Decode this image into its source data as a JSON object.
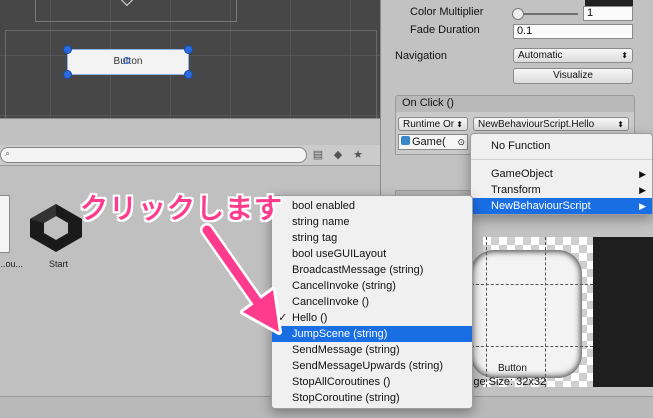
{
  "scene": {
    "button_text": "Button"
  },
  "project": {
    "assets": [
      {
        "label": "...ou..."
      },
      {
        "label": "Start"
      }
    ]
  },
  "inspector": {
    "color_multiplier_label": "Color Multiplier",
    "color_multiplier_value": "1",
    "fade_duration_label": "Fade Duration",
    "fade_duration_value": "0.1",
    "navigation_label": "Navigation",
    "navigation_value": "Automatic",
    "visualize_label": "Visualize",
    "onclick_header": "On Click ()",
    "runtime_value": "Runtime Or",
    "function_value": "NewBehaviourScript.Hello",
    "object_value": "Game("
  },
  "preview": {
    "title": "Button",
    "size_text": "Image Size: 32x32"
  },
  "function_menu": {
    "items": [
      {
        "label": "No Function"
      },
      {
        "label": "GameObject",
        "submenu": true
      },
      {
        "label": "Transform",
        "submenu": true
      },
      {
        "label": "NewBehaviourScript",
        "submenu": true,
        "selected": true
      }
    ]
  },
  "method_menu": {
    "items": [
      {
        "label": "bool enabled"
      },
      {
        "label": "string name"
      },
      {
        "label": "string tag"
      },
      {
        "label": "bool useGUILayout"
      },
      {
        "label": "BroadcastMessage (string)"
      },
      {
        "label": "CancelInvoke (string)"
      },
      {
        "label": "CancelInvoke ()"
      },
      {
        "label": "Hello ()",
        "checked": true
      },
      {
        "label": "JumpScene (string)",
        "selected": true
      },
      {
        "label": "SendMessage (string)"
      },
      {
        "label": "SendMessageUpwards (string)"
      },
      {
        "label": "StopAllCoroutines ()"
      },
      {
        "label": "StopCoroutine (string)"
      }
    ]
  },
  "annotation": {
    "text": "クリックします",
    "color": "#ff3b8d"
  },
  "colors": {
    "selection": "#1a6ee4",
    "handle": "#2b6be2"
  }
}
